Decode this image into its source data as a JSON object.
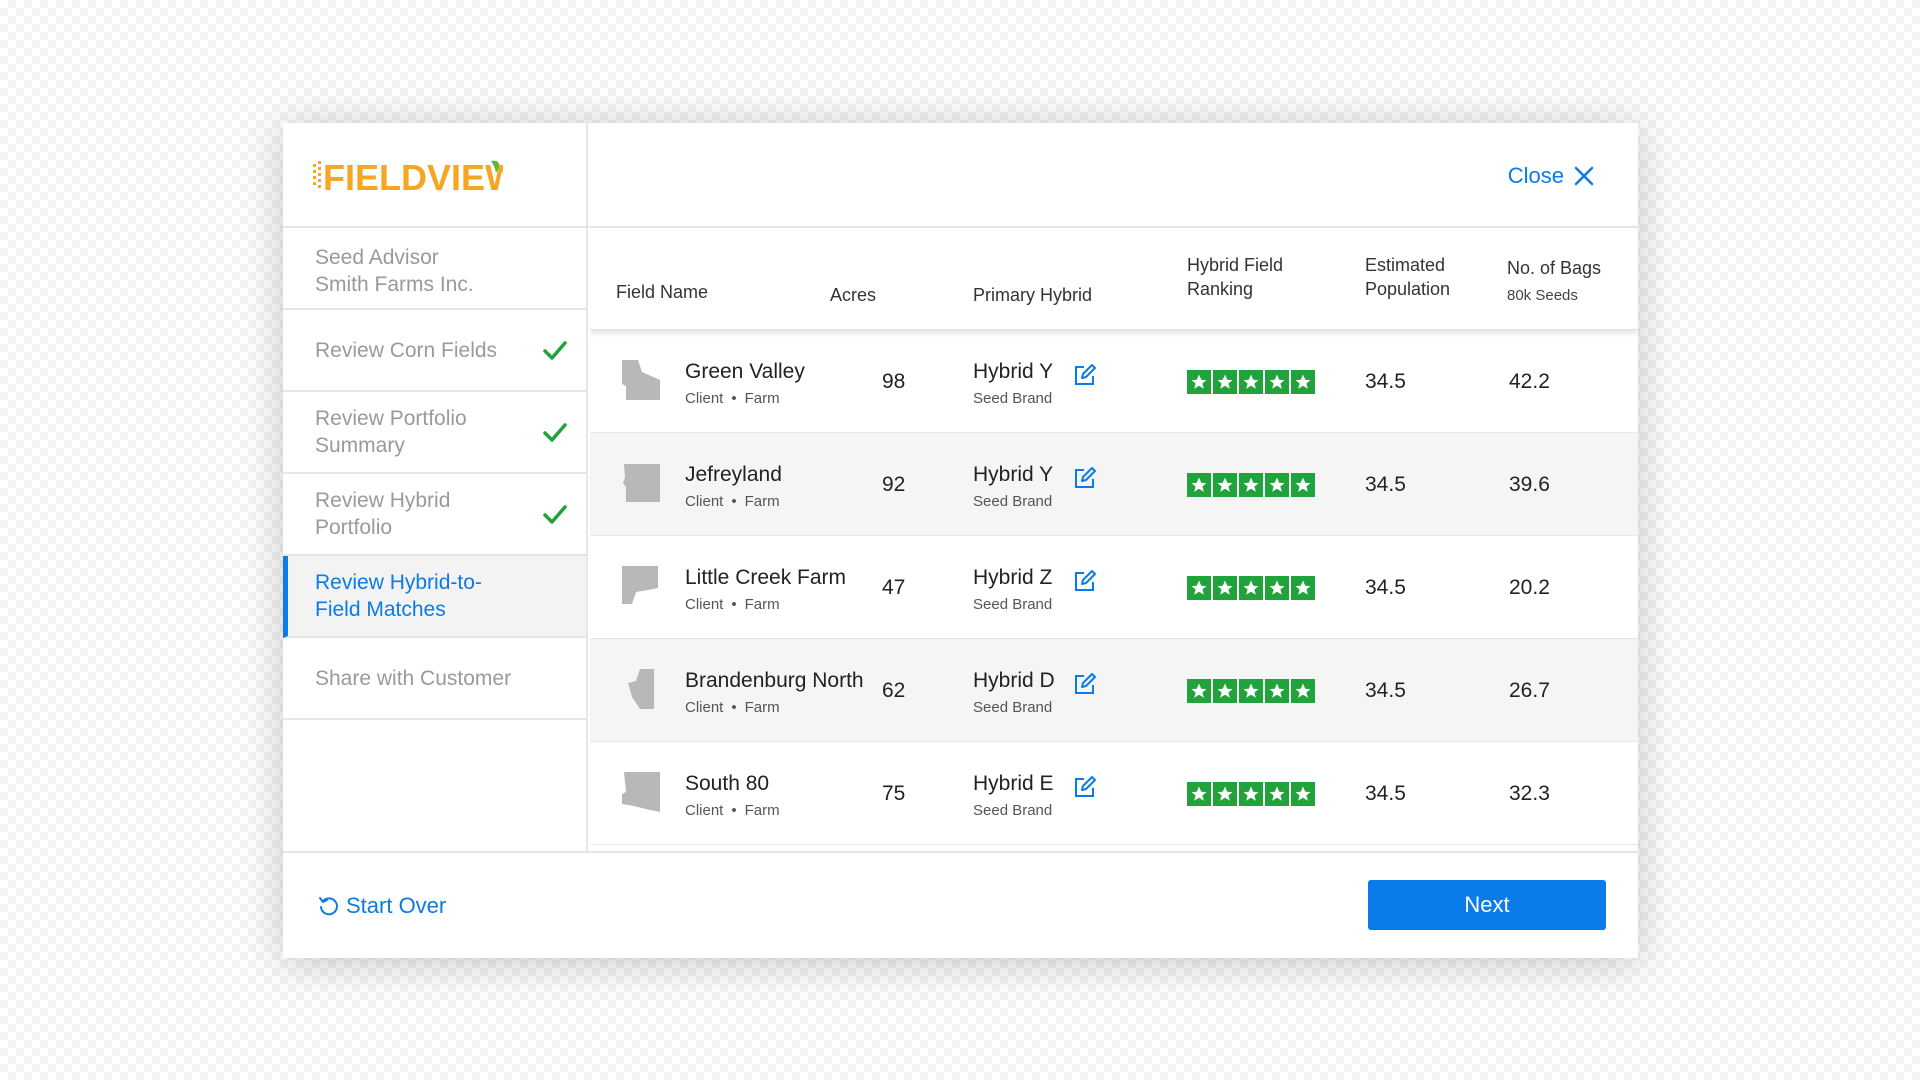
{
  "brand": {
    "logo_text": "FIELDVIEW",
    "logo_color": "#f5a623",
    "leaf_color": "#5cb82e"
  },
  "header": {
    "close_label": "Close"
  },
  "sidebar": {
    "advisor_title": "Seed Advisor",
    "advisor_client": "Smith Farms Inc.",
    "steps": [
      {
        "label": "Review Corn Fields",
        "completed": true
      },
      {
        "label": "Review Portfolio Summary",
        "completed": true
      },
      {
        "label": "Review Hybrid Portfolio",
        "completed": true
      },
      {
        "label": "Review Hybrid-to-Field Matches",
        "active": true
      },
      {
        "label": "Share with Customer",
        "completed": false
      }
    ]
  },
  "table": {
    "columns": {
      "field_name": "Field Name",
      "acres": "Acres",
      "primary_hybrid": "Primary Hybrid",
      "ranking_line1": "Hybrid Field",
      "ranking_line2": "Ranking",
      "population_line1": "Estimated",
      "population_line2": "Population",
      "bags": "No. of Bags",
      "bags_sub": "80k Seeds"
    },
    "rows": [
      {
        "name": "Green Valley",
        "client": "Client",
        "farm": "Farm",
        "acres": "98",
        "hybrid": "Hybrid Y",
        "brand": "Seed Brand",
        "stars": 5,
        "population": "34.5",
        "bags": "42.2"
      },
      {
        "name": "Jefreyland",
        "client": "Client",
        "farm": "Farm",
        "acres": "92",
        "hybrid": "Hybrid Y",
        "brand": "Seed Brand",
        "stars": 5,
        "population": "34.5",
        "bags": "39.6"
      },
      {
        "name": "Little Creek Farm",
        "client": "Client",
        "farm": "Farm",
        "acres": "47",
        "hybrid": "Hybrid Z",
        "brand": "Seed Brand",
        "stars": 5,
        "population": "34.5",
        "bags": "20.2"
      },
      {
        "name": "Brandenburg North",
        "client": "Client",
        "farm": "Farm",
        "acres": "62",
        "hybrid": "Hybrid D",
        "brand": "Seed Brand",
        "stars": 5,
        "population": "34.5",
        "bags": "26.7"
      },
      {
        "name": "South 80",
        "client": "Client",
        "farm": "Farm",
        "acres": "75",
        "hybrid": "Hybrid E",
        "brand": "Seed Brand",
        "stars": 5,
        "population": "34.5",
        "bags": "32.3"
      }
    ]
  },
  "footer": {
    "start_over_label": "Start Over",
    "next_label": "Next"
  },
  "colors": {
    "accent": "#0a7be8",
    "check": "#20a33a",
    "star_bg": "#20a33a",
    "shape": "#b8b8b8"
  }
}
